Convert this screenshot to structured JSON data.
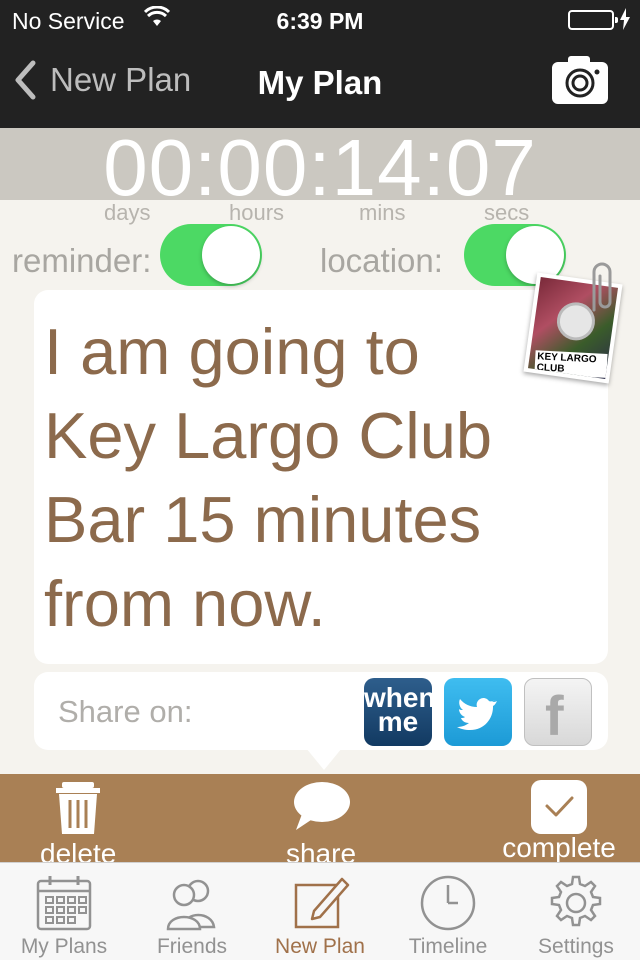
{
  "status_bar": {
    "carrier": "No Service",
    "time": "6:39 PM",
    "battery_level": 1.0
  },
  "nav": {
    "back_label": "New Plan",
    "title": "My Plan",
    "camera_icon": "camera-icon"
  },
  "countdown": {
    "value": "00:00:14:07",
    "units": {
      "days": "days",
      "hours": "hours",
      "mins": "mins",
      "secs": "secs"
    }
  },
  "toggles": {
    "reminder": {
      "label": "reminder:",
      "on": true
    },
    "location": {
      "label": "location:",
      "on": true
    }
  },
  "plan": {
    "message": "I am going to Key Largo Club Bar 15 minutes from now."
  },
  "photo": {
    "sign_text": "KEY LARGO CLUB"
  },
  "share": {
    "label": "Share on:",
    "services": [
      {
        "name": "whenme",
        "text": "when me"
      },
      {
        "name": "twitter",
        "icon": "twitter-bird-icon"
      },
      {
        "name": "facebook",
        "text": "f"
      }
    ]
  },
  "actions": {
    "delete": "delete",
    "share": "share",
    "complete": "complete"
  },
  "tabs": [
    {
      "label": "My Plans",
      "icon": "calendar-icon",
      "active": false
    },
    {
      "label": "Friends",
      "icon": "friends-icon",
      "active": false
    },
    {
      "label": "New Plan",
      "icon": "compose-icon",
      "active": true
    },
    {
      "label": "Timeline",
      "icon": "clock-icon",
      "active": false
    },
    {
      "label": "Settings",
      "icon": "gear-icon",
      "active": false
    }
  ],
  "colors": {
    "accent_brown": "#a98055",
    "message_text": "#8c6a4c",
    "toggle_on": "#4cd964",
    "nav_bg": "#222222",
    "countdown_bg": "#cbc8c1"
  }
}
